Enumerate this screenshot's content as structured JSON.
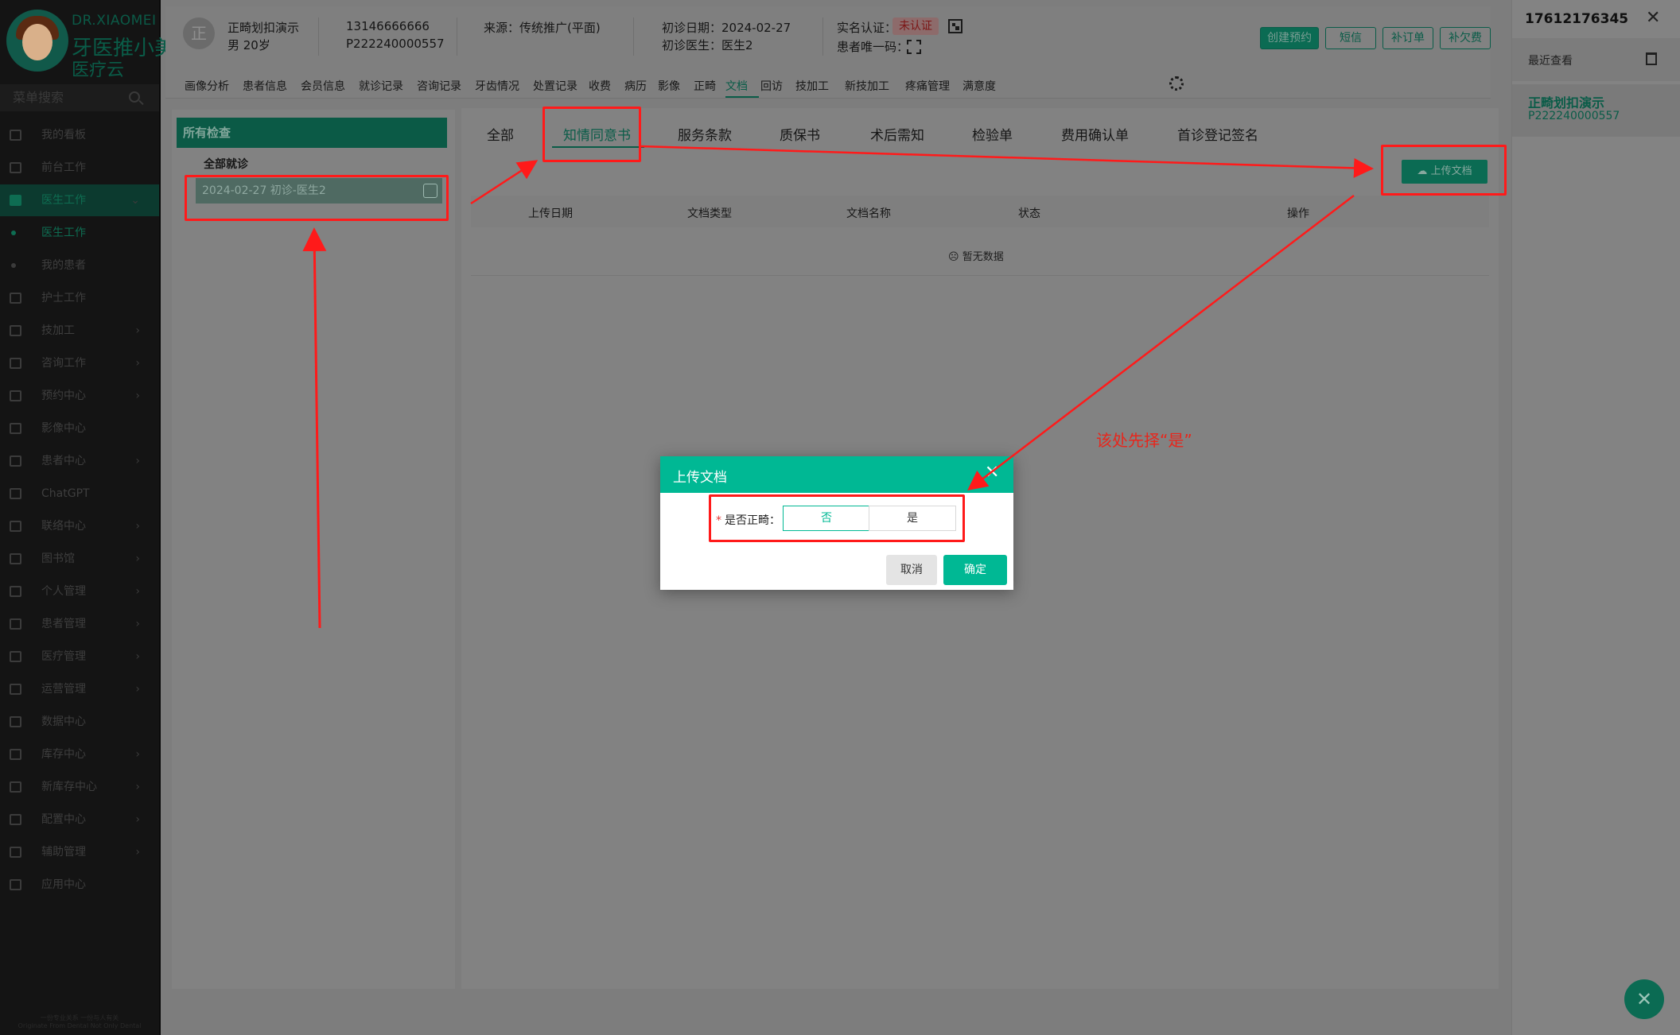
{
  "brand": {
    "en": "DR.XIAOMEI",
    "cn1": "牙医推小美",
    "cn2": "医疗云"
  },
  "sidebar": {
    "search_placeholder": "菜单搜索",
    "items": [
      {
        "label": "我的看板"
      },
      {
        "label": "前台工作"
      },
      {
        "label": "医生工作",
        "expanded": true
      },
      {
        "label": "医生工作",
        "sub": true,
        "selected": true
      },
      {
        "label": "我的患者",
        "sub": true
      },
      {
        "label": "护士工作"
      },
      {
        "label": "技加工",
        "caret": true
      },
      {
        "label": "咨询工作",
        "caret": true
      },
      {
        "label": "预约中心",
        "caret": true
      },
      {
        "label": "影像中心"
      },
      {
        "label": "患者中心",
        "caret": true
      },
      {
        "label": "ChatGPT"
      },
      {
        "label": "联络中心",
        "caret": true
      },
      {
        "label": "图书馆",
        "caret": true
      },
      {
        "label": "个人管理",
        "caret": true
      },
      {
        "label": "患者管理",
        "caret": true
      },
      {
        "label": "医疗管理",
        "caret": true
      },
      {
        "label": "运营管理",
        "caret": true
      },
      {
        "label": "数据中心"
      },
      {
        "label": "库存中心",
        "caret": true
      },
      {
        "label": "新库存中心",
        "caret": true
      },
      {
        "label": "配置中心",
        "caret": true
      },
      {
        "label": "辅助管理",
        "caret": true
      },
      {
        "label": "应用中心"
      }
    ],
    "footer_line1": "一份专业关系 一份与人有关",
    "footer_line2": "Originate From Dental Not Only Dental"
  },
  "patient": {
    "avatar_char": "正",
    "name": "正畸划扣演示",
    "gender_age": "男 20岁",
    "phone": "13146666666",
    "id": "P222240000557",
    "source": "来源：传统推广(平面)",
    "first_visit_date": "初诊日期：2024-02-27",
    "first_doctor": "初诊医生：医生2",
    "realname_label": "实名认证：",
    "realname_status": "未认证",
    "unique_code_label": "患者唯一码："
  },
  "header_buttons": {
    "create": "创建预约",
    "sms": "短信",
    "order": "补订单",
    "fee": "补欠费"
  },
  "patient_tabs": [
    "画像分析",
    "患者信息",
    "会员信息",
    "就诊记录",
    "咨询记录",
    "牙齿情况",
    "处置记录",
    "收费",
    "病历",
    "影像",
    "正畸",
    "文档",
    "回访",
    "技加工",
    "新技加工",
    "疼痛管理",
    "满意度"
  ],
  "tree": {
    "head": "所有检查",
    "all_visits": "全部就诊",
    "node": "2024-02-27 初诊-医生2"
  },
  "doc_tabs": [
    "全部",
    "知情同意书",
    "服务条款",
    "质保书",
    "术后需知",
    "检验单",
    "费用确认单",
    "首诊登记签名"
  ],
  "upload_button": "上传文档",
  "table": {
    "headers": [
      "上传日期",
      "文档类型",
      "文档名称",
      "状态",
      "操作"
    ],
    "empty": "暂无数据"
  },
  "right_panel": {
    "phone": "17612176345",
    "recent": "最近查看",
    "card_name": "正畸划扣演示",
    "card_id": "P222240000557"
  },
  "modal": {
    "title": "上传文档",
    "field_label": "是否正畸：",
    "option_no": "否",
    "option_yes": "是",
    "cancel": "取消",
    "confirm": "确定"
  },
  "annotation": "该处先择“是”",
  "colors": {
    "brand_green": "#00b894",
    "annotation_red": "#ff1a1a",
    "overlay": "#7d7d7d"
  }
}
